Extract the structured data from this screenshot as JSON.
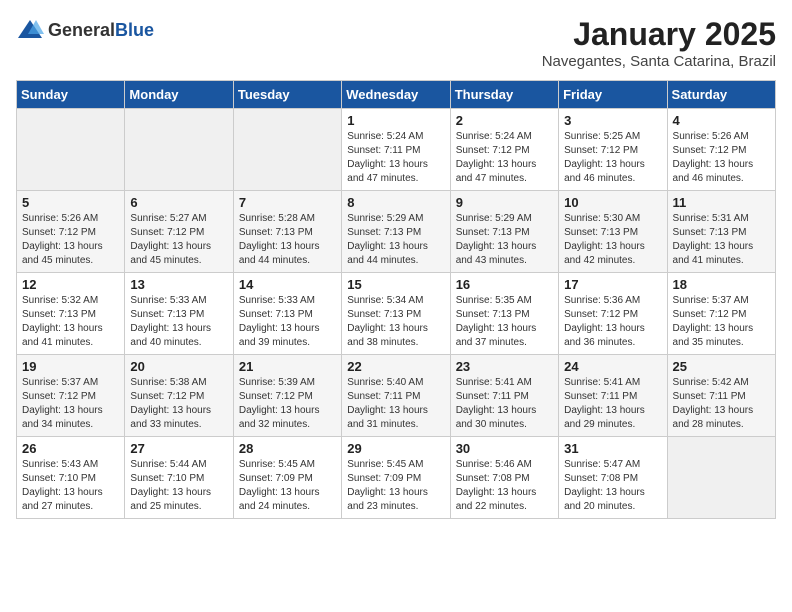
{
  "header": {
    "logo_general": "General",
    "logo_blue": "Blue",
    "month": "January 2025",
    "location": "Navegantes, Santa Catarina, Brazil"
  },
  "weekdays": [
    "Sunday",
    "Monday",
    "Tuesday",
    "Wednesday",
    "Thursday",
    "Friday",
    "Saturday"
  ],
  "weeks": [
    [
      {
        "day": "",
        "sunrise": "",
        "sunset": "",
        "daylight": ""
      },
      {
        "day": "",
        "sunrise": "",
        "sunset": "",
        "daylight": ""
      },
      {
        "day": "",
        "sunrise": "",
        "sunset": "",
        "daylight": ""
      },
      {
        "day": "1",
        "sunrise": "Sunrise: 5:24 AM",
        "sunset": "Sunset: 7:11 PM",
        "daylight": "Daylight: 13 hours and 47 minutes."
      },
      {
        "day": "2",
        "sunrise": "Sunrise: 5:24 AM",
        "sunset": "Sunset: 7:12 PM",
        "daylight": "Daylight: 13 hours and 47 minutes."
      },
      {
        "day": "3",
        "sunrise": "Sunrise: 5:25 AM",
        "sunset": "Sunset: 7:12 PM",
        "daylight": "Daylight: 13 hours and 46 minutes."
      },
      {
        "day": "4",
        "sunrise": "Sunrise: 5:26 AM",
        "sunset": "Sunset: 7:12 PM",
        "daylight": "Daylight: 13 hours and 46 minutes."
      }
    ],
    [
      {
        "day": "5",
        "sunrise": "Sunrise: 5:26 AM",
        "sunset": "Sunset: 7:12 PM",
        "daylight": "Daylight: 13 hours and 45 minutes."
      },
      {
        "day": "6",
        "sunrise": "Sunrise: 5:27 AM",
        "sunset": "Sunset: 7:12 PM",
        "daylight": "Daylight: 13 hours and 45 minutes."
      },
      {
        "day": "7",
        "sunrise": "Sunrise: 5:28 AM",
        "sunset": "Sunset: 7:13 PM",
        "daylight": "Daylight: 13 hours and 44 minutes."
      },
      {
        "day": "8",
        "sunrise": "Sunrise: 5:29 AM",
        "sunset": "Sunset: 7:13 PM",
        "daylight": "Daylight: 13 hours and 44 minutes."
      },
      {
        "day": "9",
        "sunrise": "Sunrise: 5:29 AM",
        "sunset": "Sunset: 7:13 PM",
        "daylight": "Daylight: 13 hours and 43 minutes."
      },
      {
        "day": "10",
        "sunrise": "Sunrise: 5:30 AM",
        "sunset": "Sunset: 7:13 PM",
        "daylight": "Daylight: 13 hours and 42 minutes."
      },
      {
        "day": "11",
        "sunrise": "Sunrise: 5:31 AM",
        "sunset": "Sunset: 7:13 PM",
        "daylight": "Daylight: 13 hours and 41 minutes."
      }
    ],
    [
      {
        "day": "12",
        "sunrise": "Sunrise: 5:32 AM",
        "sunset": "Sunset: 7:13 PM",
        "daylight": "Daylight: 13 hours and 41 minutes."
      },
      {
        "day": "13",
        "sunrise": "Sunrise: 5:33 AM",
        "sunset": "Sunset: 7:13 PM",
        "daylight": "Daylight: 13 hours and 40 minutes."
      },
      {
        "day": "14",
        "sunrise": "Sunrise: 5:33 AM",
        "sunset": "Sunset: 7:13 PM",
        "daylight": "Daylight: 13 hours and 39 minutes."
      },
      {
        "day": "15",
        "sunrise": "Sunrise: 5:34 AM",
        "sunset": "Sunset: 7:13 PM",
        "daylight": "Daylight: 13 hours and 38 minutes."
      },
      {
        "day": "16",
        "sunrise": "Sunrise: 5:35 AM",
        "sunset": "Sunset: 7:13 PM",
        "daylight": "Daylight: 13 hours and 37 minutes."
      },
      {
        "day": "17",
        "sunrise": "Sunrise: 5:36 AM",
        "sunset": "Sunset: 7:12 PM",
        "daylight": "Daylight: 13 hours and 36 minutes."
      },
      {
        "day": "18",
        "sunrise": "Sunrise: 5:37 AM",
        "sunset": "Sunset: 7:12 PM",
        "daylight": "Daylight: 13 hours and 35 minutes."
      }
    ],
    [
      {
        "day": "19",
        "sunrise": "Sunrise: 5:37 AM",
        "sunset": "Sunset: 7:12 PM",
        "daylight": "Daylight: 13 hours and 34 minutes."
      },
      {
        "day": "20",
        "sunrise": "Sunrise: 5:38 AM",
        "sunset": "Sunset: 7:12 PM",
        "daylight": "Daylight: 13 hours and 33 minutes."
      },
      {
        "day": "21",
        "sunrise": "Sunrise: 5:39 AM",
        "sunset": "Sunset: 7:12 PM",
        "daylight": "Daylight: 13 hours and 32 minutes."
      },
      {
        "day": "22",
        "sunrise": "Sunrise: 5:40 AM",
        "sunset": "Sunset: 7:11 PM",
        "daylight": "Daylight: 13 hours and 31 minutes."
      },
      {
        "day": "23",
        "sunrise": "Sunrise: 5:41 AM",
        "sunset": "Sunset: 7:11 PM",
        "daylight": "Daylight: 13 hours and 30 minutes."
      },
      {
        "day": "24",
        "sunrise": "Sunrise: 5:41 AM",
        "sunset": "Sunset: 7:11 PM",
        "daylight": "Daylight: 13 hours and 29 minutes."
      },
      {
        "day": "25",
        "sunrise": "Sunrise: 5:42 AM",
        "sunset": "Sunset: 7:11 PM",
        "daylight": "Daylight: 13 hours and 28 minutes."
      }
    ],
    [
      {
        "day": "26",
        "sunrise": "Sunrise: 5:43 AM",
        "sunset": "Sunset: 7:10 PM",
        "daylight": "Daylight: 13 hours and 27 minutes."
      },
      {
        "day": "27",
        "sunrise": "Sunrise: 5:44 AM",
        "sunset": "Sunset: 7:10 PM",
        "daylight": "Daylight: 13 hours and 25 minutes."
      },
      {
        "day": "28",
        "sunrise": "Sunrise: 5:45 AM",
        "sunset": "Sunset: 7:09 PM",
        "daylight": "Daylight: 13 hours and 24 minutes."
      },
      {
        "day": "29",
        "sunrise": "Sunrise: 5:45 AM",
        "sunset": "Sunset: 7:09 PM",
        "daylight": "Daylight: 13 hours and 23 minutes."
      },
      {
        "day": "30",
        "sunrise": "Sunrise: 5:46 AM",
        "sunset": "Sunset: 7:08 PM",
        "daylight": "Daylight: 13 hours and 22 minutes."
      },
      {
        "day": "31",
        "sunrise": "Sunrise: 5:47 AM",
        "sunset": "Sunset: 7:08 PM",
        "daylight": "Daylight: 13 hours and 20 minutes."
      },
      {
        "day": "",
        "sunrise": "",
        "sunset": "",
        "daylight": ""
      }
    ]
  ]
}
